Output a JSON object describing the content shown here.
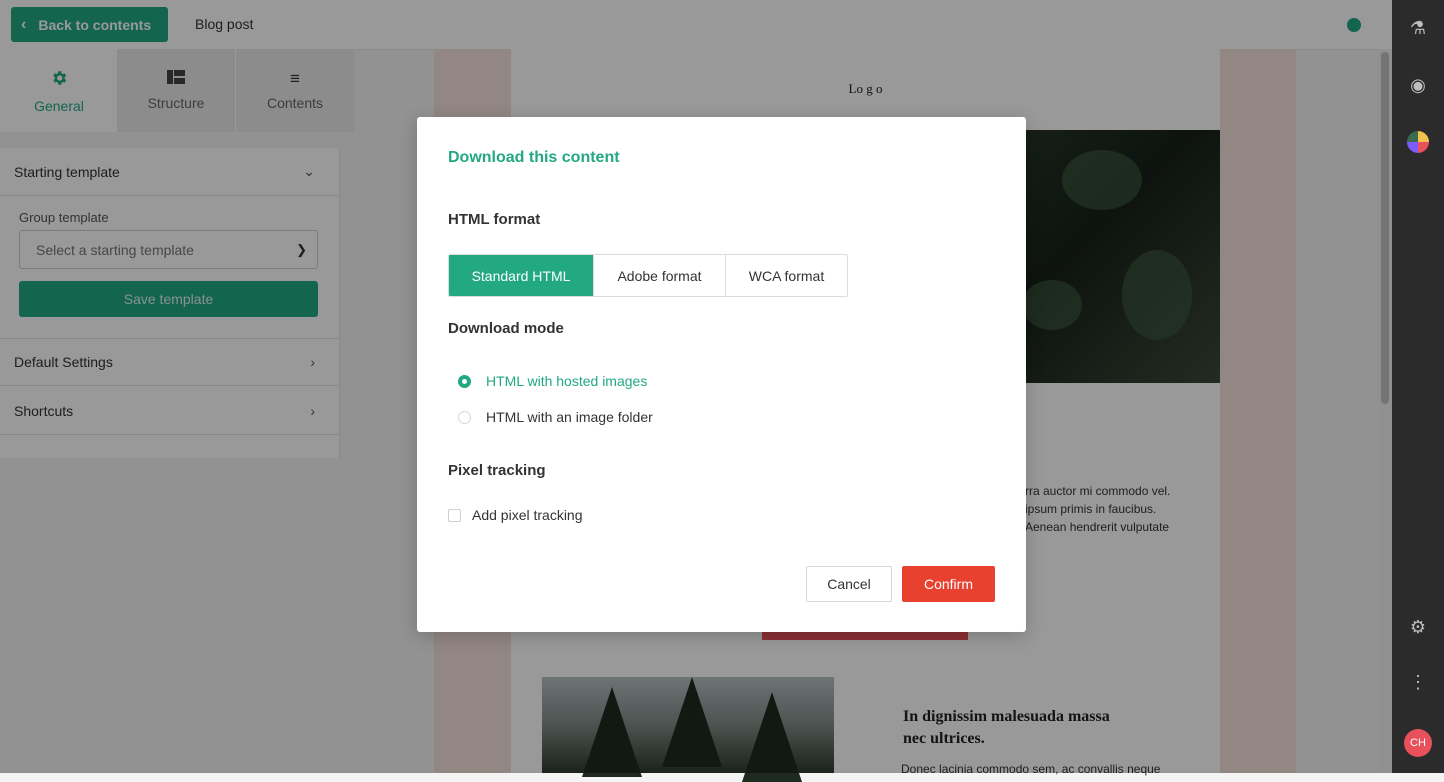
{
  "topbar": {
    "back_label": "Back to contents",
    "doc_title": "Blog post",
    "status_color": "#22a882"
  },
  "sidebar": {
    "tabs": [
      {
        "label": "General",
        "icon": "gear-icon",
        "active": true
      },
      {
        "label": "Structure",
        "icon": "layout-icon",
        "active": false
      },
      {
        "label": "Contents",
        "icon": "list-icon",
        "active": false
      }
    ],
    "starting_template": {
      "title": "Starting template",
      "group_label": "Group template",
      "select_placeholder": "Select a starting template",
      "save_label": "Save template"
    },
    "default_settings": "Default Settings",
    "shortcuts": "Shortcuts"
  },
  "email_preview": {
    "logo": "Lo g o",
    "body_text": "rra auctor mi commodo vel.\nipsum primis in faucibus.\nAenean hendrerit vulputate",
    "heading2": "In dignissim malesuada massa nec ultrices.",
    "body2": "Donec lacinia commodo sem, ac convallis neque"
  },
  "modal": {
    "title": "Download this content",
    "html_format_label": "HTML format",
    "formats": [
      "Standard HTML",
      "Adobe format",
      "WCA format"
    ],
    "selected_format": "Standard HTML",
    "download_mode_label": "Download mode",
    "modes": [
      "HTML with hosted images",
      "HTML with an image folder"
    ],
    "selected_mode": "HTML with hosted images",
    "pixel_tracking_label": "Pixel tracking",
    "pixel_tracking_option": "Add pixel tracking",
    "pixel_tracking_checked": false,
    "cancel_label": "Cancel",
    "confirm_label": "Confirm"
  },
  "rail": {
    "icons": [
      "flask-icon",
      "eye-icon",
      "palette-icon",
      "gear-icon",
      "more-icon"
    ],
    "avatar_initials": "CH"
  },
  "colors": {
    "accent": "#22a882",
    "confirm": "#e8412f",
    "rail_bg": "#2b2b2b"
  }
}
